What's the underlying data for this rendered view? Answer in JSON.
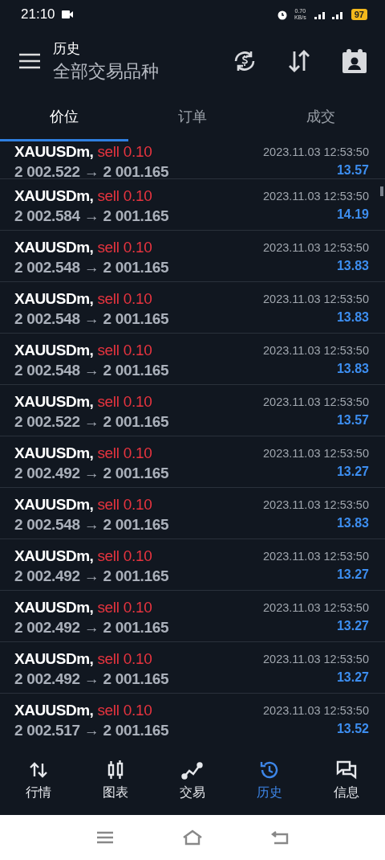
{
  "status_bar": {
    "time": "21:10",
    "speed": "0.70",
    "speed_unit": "KB/s",
    "battery": "97"
  },
  "header": {
    "title": "历史",
    "subtitle": "全部交易品种"
  },
  "tabs": [
    {
      "label": "价位",
      "selected": true
    },
    {
      "label": "订单",
      "selected": false
    },
    {
      "label": "成交",
      "selected": false
    }
  ],
  "deals": [
    {
      "symbol": "XAUUSDm,",
      "side": "sell 0.10",
      "prices": "2 002.522 → 2 001.165",
      "time": "2023.11.03 12:53:50",
      "profit": "13.57"
    },
    {
      "symbol": "XAUUSDm,",
      "side": "sell 0.10",
      "prices": "2 002.584 → 2 001.165",
      "time": "2023.11.03 12:53:50",
      "profit": "14.19"
    },
    {
      "symbol": "XAUUSDm,",
      "side": "sell 0.10",
      "prices": "2 002.548 → 2 001.165",
      "time": "2023.11.03 12:53:50",
      "profit": "13.83"
    },
    {
      "symbol": "XAUUSDm,",
      "side": "sell 0.10",
      "prices": "2 002.548 → 2 001.165",
      "time": "2023.11.03 12:53:50",
      "profit": "13.83"
    },
    {
      "symbol": "XAUUSDm,",
      "side": "sell 0.10",
      "prices": "2 002.548 → 2 001.165",
      "time": "2023.11.03 12:53:50",
      "profit": "13.83"
    },
    {
      "symbol": "XAUUSDm,",
      "side": "sell 0.10",
      "prices": "2 002.522 → 2 001.165",
      "time": "2023.11.03 12:53:50",
      "profit": "13.57"
    },
    {
      "symbol": "XAUUSDm,",
      "side": "sell 0.10",
      "prices": "2 002.492 → 2 001.165",
      "time": "2023.11.03 12:53:50",
      "profit": "13.27"
    },
    {
      "symbol": "XAUUSDm,",
      "side": "sell 0.10",
      "prices": "2 002.548 → 2 001.165",
      "time": "2023.11.03 12:53:50",
      "profit": "13.83"
    },
    {
      "symbol": "XAUUSDm,",
      "side": "sell 0.10",
      "prices": "2 002.492 → 2 001.165",
      "time": "2023.11.03 12:53:50",
      "profit": "13.27"
    },
    {
      "symbol": "XAUUSDm,",
      "side": "sell 0.10",
      "prices": "2 002.492 → 2 001.165",
      "time": "2023.11.03 12:53:50",
      "profit": "13.27"
    },
    {
      "symbol": "XAUUSDm,",
      "side": "sell 0.10",
      "prices": "2 002.492 → 2 001.165",
      "time": "2023.11.03 12:53:50",
      "profit": "13.27"
    },
    {
      "symbol": "XAUUSDm,",
      "side": "sell 0.10",
      "prices": "2 002.517 → 2 001.165",
      "time": "2023.11.03 12:53:50",
      "profit": "13.52"
    }
  ],
  "bottom_nav": [
    {
      "kind": "quotes",
      "label": "行情",
      "selected": false
    },
    {
      "kind": "chart",
      "label": "图表",
      "selected": false
    },
    {
      "kind": "trade",
      "label": "交易",
      "selected": false
    },
    {
      "kind": "history",
      "label": "历史",
      "selected": true
    },
    {
      "kind": "messages",
      "label": "信息",
      "selected": false
    }
  ]
}
